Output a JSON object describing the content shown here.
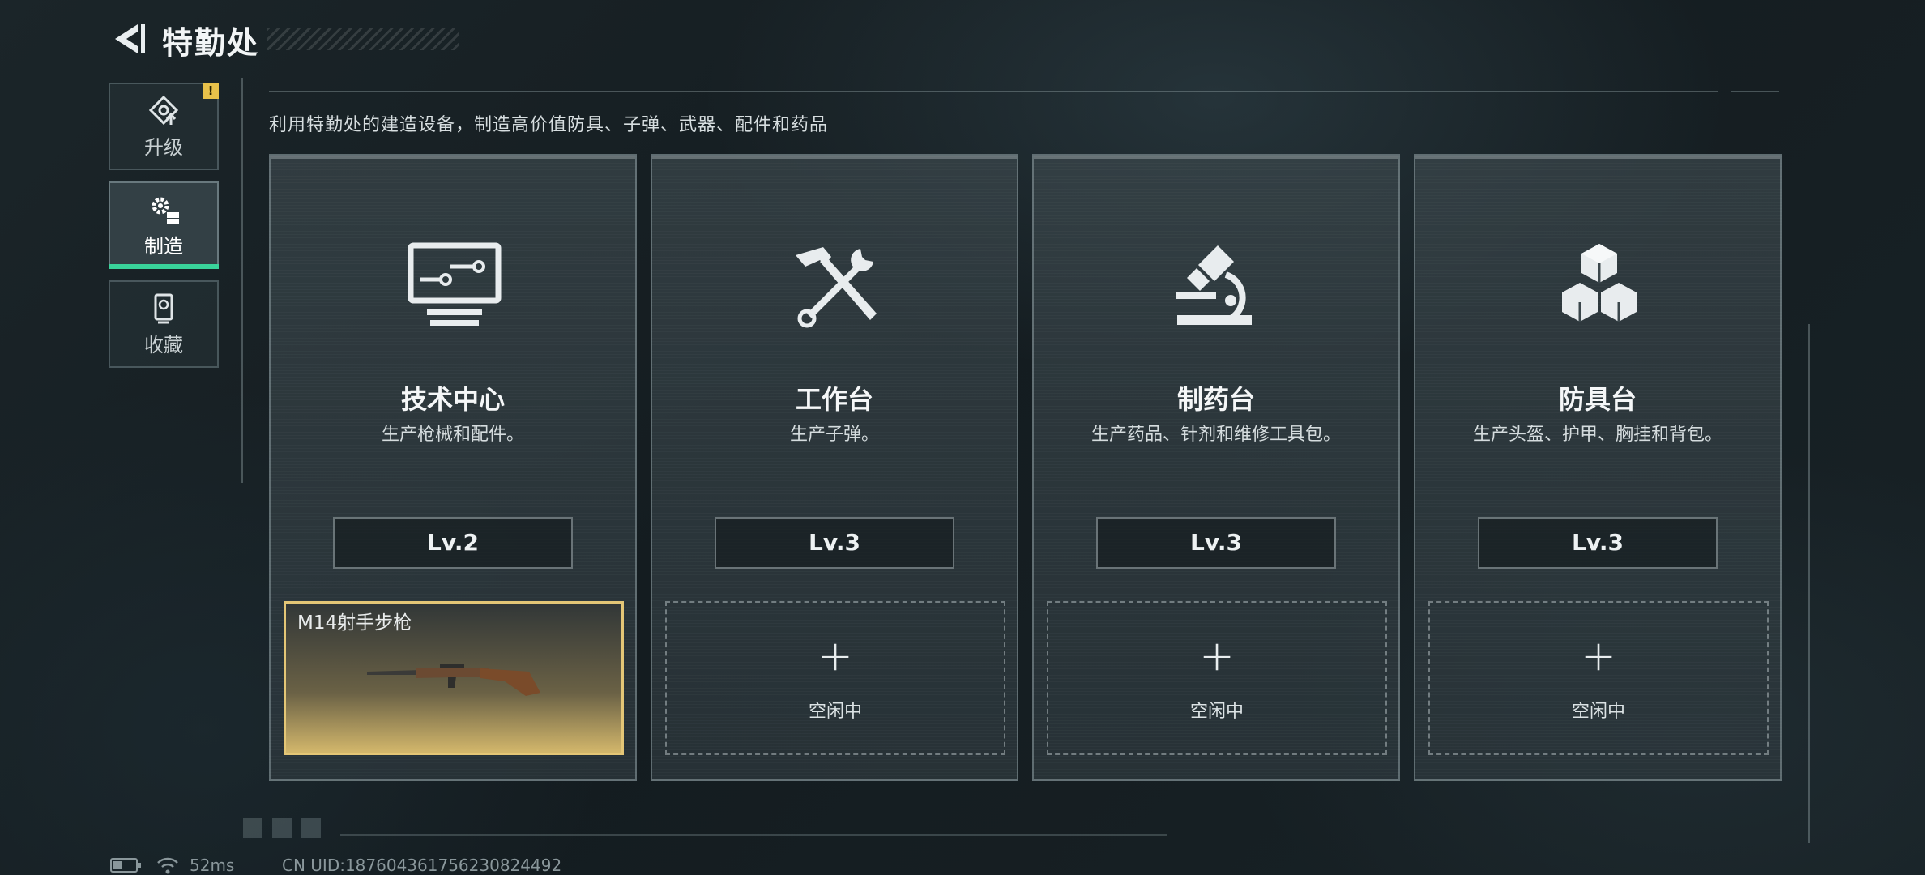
{
  "header": {
    "title": "特勤处"
  },
  "sidebar": {
    "alert": "!",
    "items": [
      {
        "label": "升级",
        "icon": "upgrade-icon"
      },
      {
        "label": "制造",
        "icon": "crafting-gears-icon",
        "active": true
      },
      {
        "label": "收藏",
        "icon": "collection-icon"
      }
    ]
  },
  "description": "利用特勤处的建造设备，制造高价值防具、子弹、武器、配件和药品",
  "stations": [
    {
      "name": "技术中心",
      "desc": "生产枪械和配件。",
      "level": "Lv.2",
      "icon": "monitor-circuit-icon",
      "slot": {
        "busy": true,
        "item": "M14射手步枪",
        "item_icon": "rifle-icon"
      }
    },
    {
      "name": "工作台",
      "desc": "生产子弹。",
      "level": "Lv.3",
      "icon": "hammer-wrench-icon",
      "slot": {
        "busy": false,
        "plus": "+",
        "status": "空闲中"
      }
    },
    {
      "name": "制药台",
      "desc": "生产药品、针剂和维修工具包。",
      "level": "Lv.3",
      "icon": "microscope-icon",
      "slot": {
        "busy": false,
        "plus": "+",
        "status": "空闲中"
      }
    },
    {
      "name": "防具台",
      "desc": "生产头盔、护甲、胸挂和背包。",
      "level": "Lv.3",
      "icon": "armor-boxes-icon",
      "slot": {
        "busy": false,
        "plus": "+",
        "status": "空闲中"
      }
    }
  ],
  "footer": {
    "ping": "52ms",
    "uid": "CN UID:187604361756230824492"
  },
  "colors": {
    "accent": "#39d39a",
    "alert": "#e8c14a",
    "busy_border": "#e4c676"
  }
}
